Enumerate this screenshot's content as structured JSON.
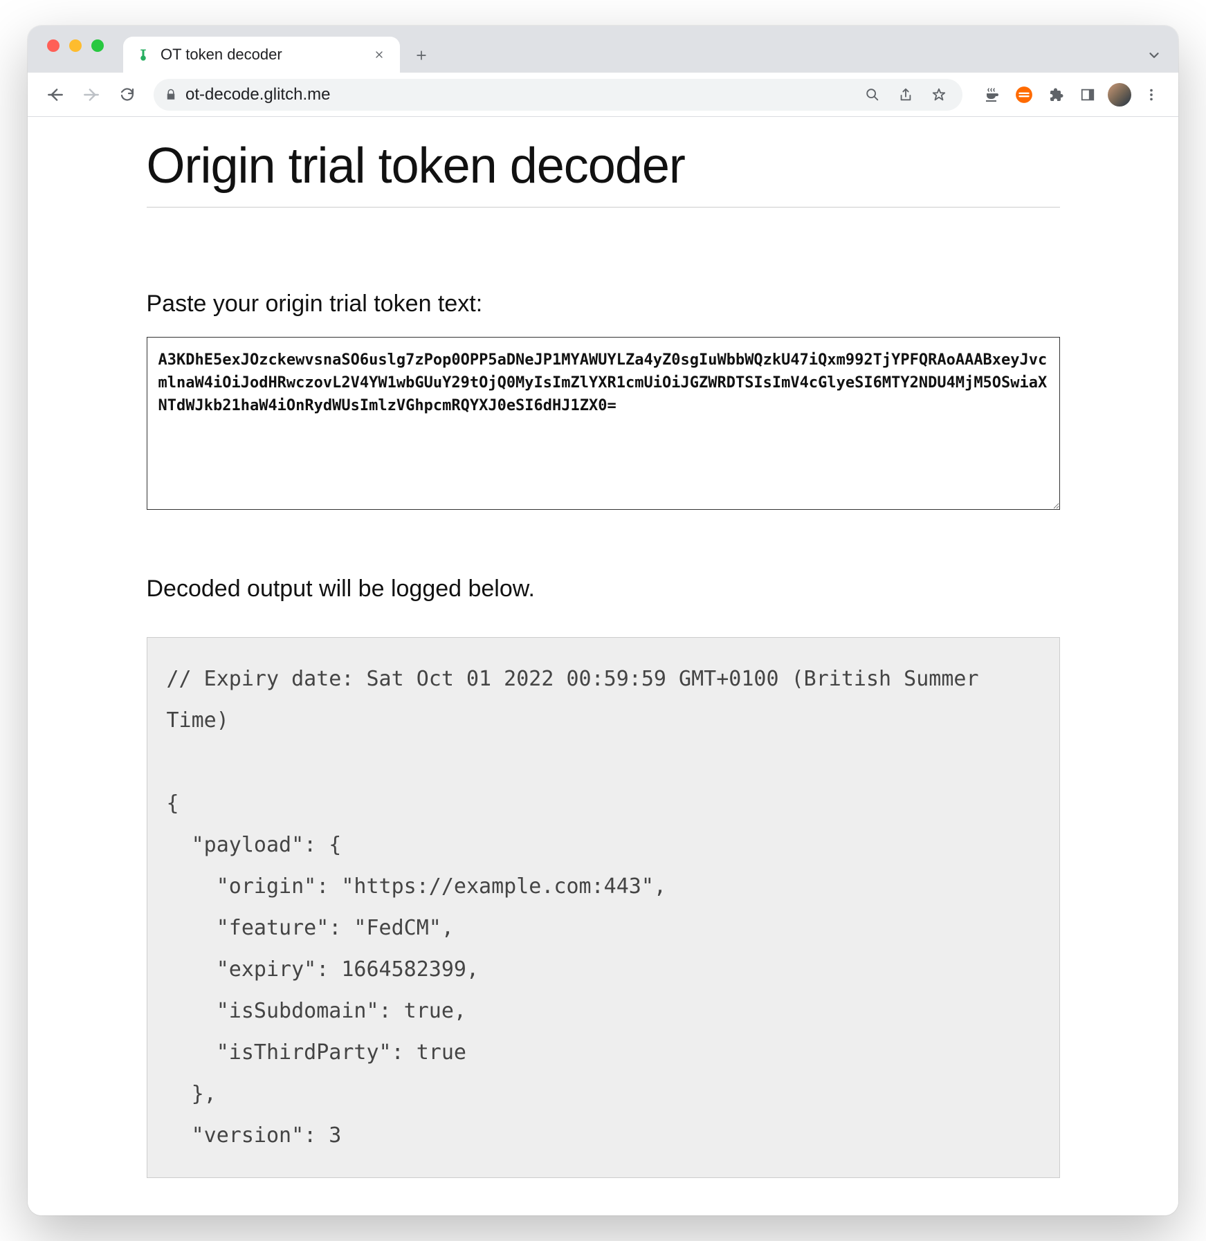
{
  "browser": {
    "tab_title": "OT token decoder",
    "url": "ot-decode.glitch.me"
  },
  "page": {
    "heading": "Origin trial token decoder",
    "input_label": "Paste your origin trial token text:",
    "token_value": "A3KDhE5exJOzckewvsnaSO6uslg7zPop0OPP5aDNeJP1MYAWUYLZa4yZ0sgIuWbbWQzkU47iQxm992TjYPFQRAoAAABxeyJvcmlnaW4iOiJodHRwczovL2V4YW1wbGUuY29tOjQ0MyIsImZlYXR1cmUiOiJGZWRDTSIsImV4cGlyeSI6MTY2NDU4MjM5OSwiaXNTdWJkb21haW4iOnRydWUsImlzVGhpcmRQYXJ0eSI6dHJ1ZX0=",
    "output_label": "Decoded output will be logged below.",
    "decoded_comment": "// Expiry date: Sat Oct 01 2022 00:59:59 GMT+0100 (British Summer Time)",
    "decoded_json_text": "{\n  \"payload\": {\n    \"origin\": \"https://example.com:443\",\n    \"feature\": \"FedCM\",\n    \"expiry\": 1664582399,\n    \"isSubdomain\": true,\n    \"isThirdParty\": true\n  },\n  \"version\": 3",
    "decoded": {
      "expiry_date_human": "Sat Oct 01 2022 00:59:59 GMT+0100 (British Summer Time)",
      "payload": {
        "origin": "https://example.com:443",
        "feature": "FedCM",
        "expiry": 1664582399,
        "isSubdomain": true,
        "isThirdParty": true
      },
      "version": 3
    }
  }
}
